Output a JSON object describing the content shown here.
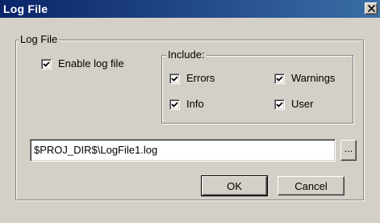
{
  "window": {
    "title": "Log File"
  },
  "titlebar": {
    "close_icon": "close-icon"
  },
  "log_group": {
    "label": "Log File"
  },
  "enable_log": {
    "label": "Enable log file",
    "checked": true
  },
  "include_group": {
    "label": "Include:",
    "options": [
      {
        "label": "Errors",
        "checked": true
      },
      {
        "label": "Warnings",
        "checked": true
      },
      {
        "label": "Info",
        "checked": true
      },
      {
        "label": "User",
        "checked": true
      }
    ]
  },
  "path_field": {
    "value": "$PROJ_DIR$\\LogFile1.log"
  },
  "browse_button": {
    "label": "..."
  },
  "buttons": {
    "ok": "OK",
    "cancel": "Cancel"
  }
}
